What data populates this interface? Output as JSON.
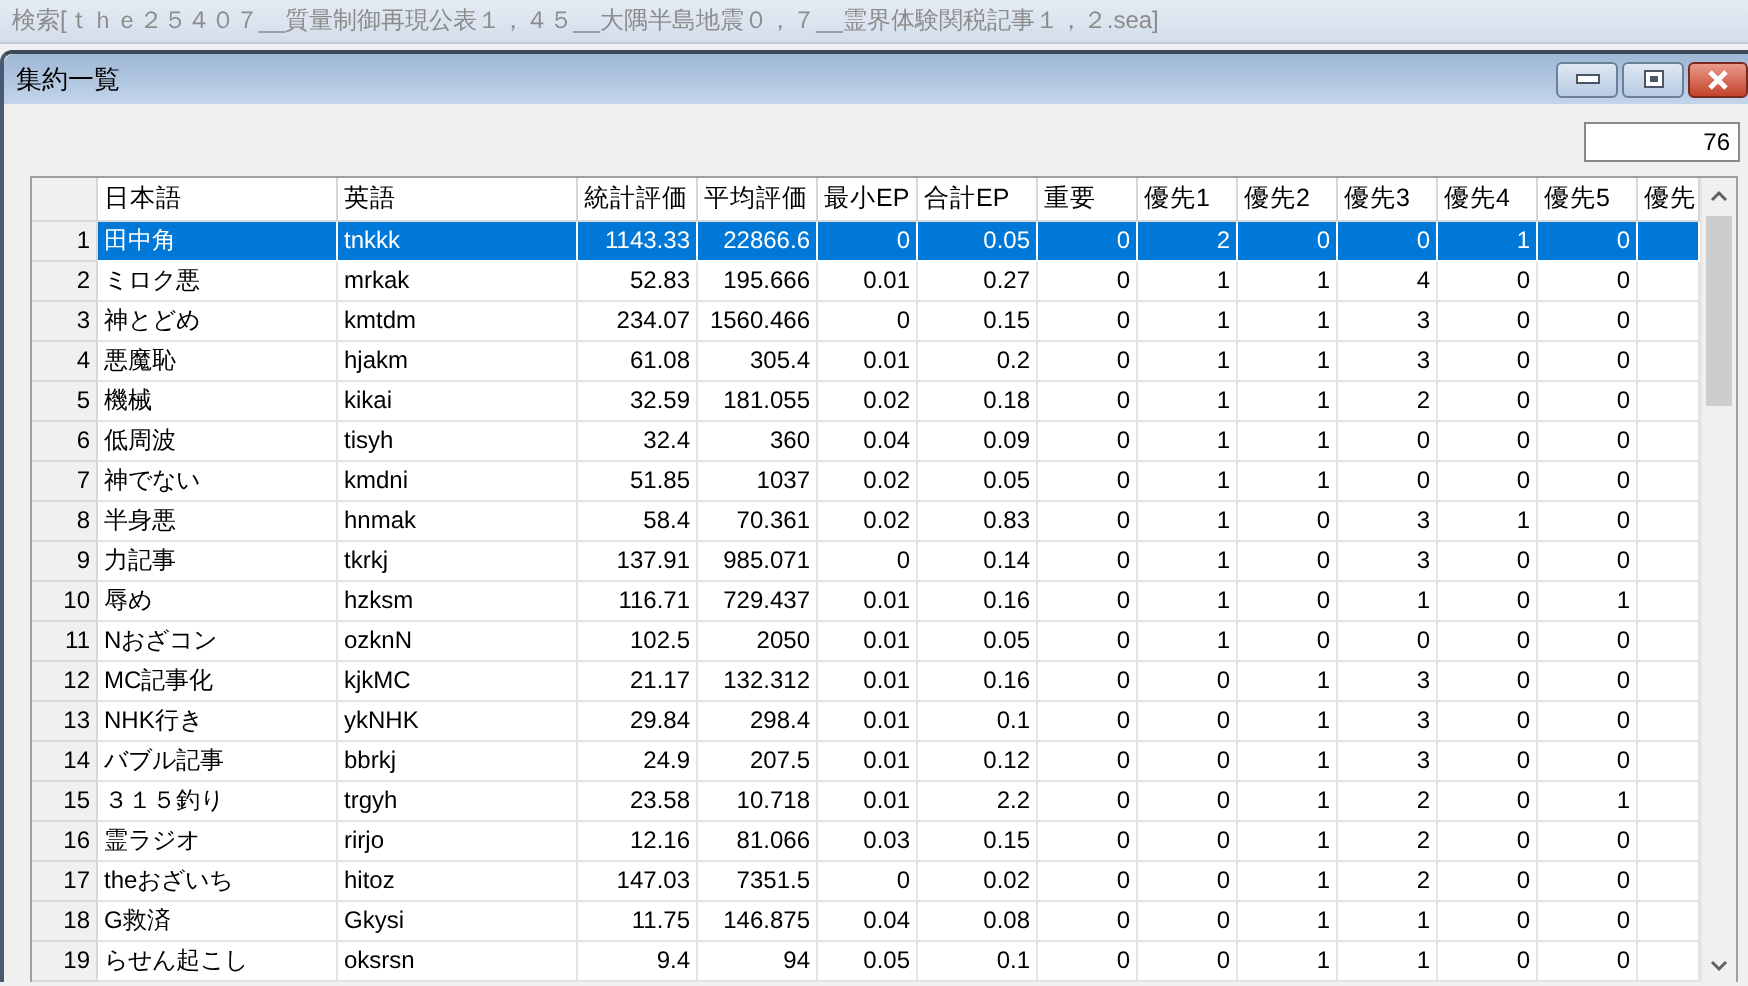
{
  "background_window": {
    "title": "検索[ｔｈｅ２５４０７__質量制御再現公表１，４５__大隅半島地震０，７__霊界体験関税記事１，２.sea]"
  },
  "window": {
    "title": "集約一覧"
  },
  "count": "76",
  "table": {
    "columns": [
      "日本語",
      "英語",
      "統計評価",
      "平均評価",
      "最小EP",
      "合計EP",
      "重要",
      "優先1",
      "優先2",
      "優先3",
      "優先4",
      "優先5",
      "優先"
    ],
    "rows": [
      {
        "number": "1",
        "selected": true,
        "cells": [
          "田中角",
          "tnkkk",
          "1143.33",
          "22866.6",
          "0",
          "0.05",
          "0",
          "2",
          "0",
          "0",
          "1",
          "0"
        ]
      },
      {
        "number": "2",
        "selected": false,
        "cells": [
          "ミロク悪",
          "mrkak",
          "52.83",
          "195.666",
          "0.01",
          "0.27",
          "0",
          "1",
          "1",
          "4",
          "0",
          "0"
        ]
      },
      {
        "number": "3",
        "selected": false,
        "cells": [
          "神とどめ",
          "kmtdm",
          "234.07",
          "1560.466",
          "0",
          "0.15",
          "0",
          "1",
          "1",
          "3",
          "0",
          "0"
        ]
      },
      {
        "number": "4",
        "selected": false,
        "cells": [
          "悪魔恥",
          "hjakm",
          "61.08",
          "305.4",
          "0.01",
          "0.2",
          "0",
          "1",
          "1",
          "3",
          "0",
          "0"
        ]
      },
      {
        "number": "5",
        "selected": false,
        "cells": [
          "機械",
          "kikai",
          "32.59",
          "181.055",
          "0.02",
          "0.18",
          "0",
          "1",
          "1",
          "2",
          "0",
          "0"
        ]
      },
      {
        "number": "6",
        "selected": false,
        "cells": [
          "低周波",
          "tisyh",
          "32.4",
          "360",
          "0.04",
          "0.09",
          "0",
          "1",
          "1",
          "0",
          "0",
          "0"
        ]
      },
      {
        "number": "7",
        "selected": false,
        "cells": [
          "神でない",
          "kmdni",
          "51.85",
          "1037",
          "0.02",
          "0.05",
          "0",
          "1",
          "1",
          "0",
          "0",
          "0"
        ]
      },
      {
        "number": "8",
        "selected": false,
        "cells": [
          "半身悪",
          "hnmak",
          "58.4",
          "70.361",
          "0.02",
          "0.83",
          "0",
          "1",
          "0",
          "3",
          "1",
          "0"
        ]
      },
      {
        "number": "9",
        "selected": false,
        "cells": [
          "力記事",
          "tkrkj",
          "137.91",
          "985.071",
          "0",
          "0.14",
          "0",
          "1",
          "0",
          "3",
          "0",
          "0"
        ]
      },
      {
        "number": "10",
        "selected": false,
        "cells": [
          "辱め",
          "hzksm",
          "116.71",
          "729.437",
          "0.01",
          "0.16",
          "0",
          "1",
          "0",
          "1",
          "0",
          "1"
        ]
      },
      {
        "number": "11",
        "selected": false,
        "cells": [
          "Nおざコン",
          "ozknN",
          "102.5",
          "2050",
          "0.01",
          "0.05",
          "0",
          "1",
          "0",
          "0",
          "0",
          "0"
        ]
      },
      {
        "number": "12",
        "selected": false,
        "cells": [
          "MC記事化",
          "kjkMC",
          "21.17",
          "132.312",
          "0.01",
          "0.16",
          "0",
          "0",
          "1",
          "3",
          "0",
          "0"
        ]
      },
      {
        "number": "13",
        "selected": false,
        "cells": [
          "NHK行き",
          "ykNHK",
          "29.84",
          "298.4",
          "0.01",
          "0.1",
          "0",
          "0",
          "1",
          "3",
          "0",
          "0"
        ]
      },
      {
        "number": "14",
        "selected": false,
        "cells": [
          "バブル記事",
          "bbrkj",
          "24.9",
          "207.5",
          "0.01",
          "0.12",
          "0",
          "0",
          "1",
          "3",
          "0",
          "0"
        ]
      },
      {
        "number": "15",
        "selected": false,
        "cells": [
          "３１５釣り",
          "trgyh",
          "23.58",
          "10.718",
          "0.01",
          "2.2",
          "0",
          "0",
          "1",
          "2",
          "0",
          "1"
        ]
      },
      {
        "number": "16",
        "selected": false,
        "cells": [
          "霊ラジオ",
          "rirjo",
          "12.16",
          "81.066",
          "0.03",
          "0.15",
          "0",
          "0",
          "1",
          "2",
          "0",
          "0"
        ]
      },
      {
        "number": "17",
        "selected": false,
        "cells": [
          "theおざいち",
          "hitoz",
          "147.03",
          "7351.5",
          "0",
          "0.02",
          "0",
          "0",
          "1",
          "2",
          "0",
          "0"
        ]
      },
      {
        "number": "18",
        "selected": false,
        "cells": [
          "G救済",
          "Gkysi",
          "11.75",
          "146.875",
          "0.04",
          "0.08",
          "0",
          "0",
          "1",
          "1",
          "0",
          "0"
        ]
      },
      {
        "number": "19",
        "selected": false,
        "cells": [
          "らせん起こし",
          "oksrsn",
          "9.4",
          "94",
          "0.05",
          "0.1",
          "0",
          "0",
          "1",
          "1",
          "0",
          "0"
        ]
      }
    ]
  }
}
